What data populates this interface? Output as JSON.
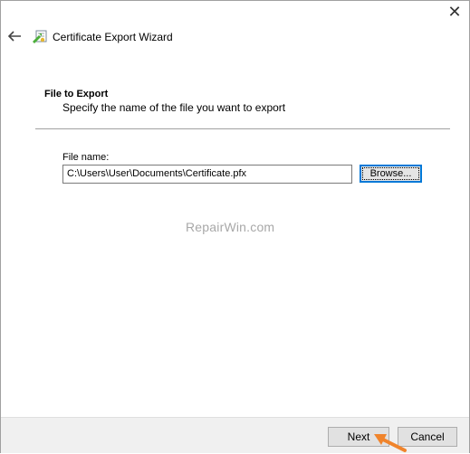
{
  "window": {
    "title": "Certificate Export Wizard",
    "close_icon": "close-icon",
    "back_icon": "back-arrow-icon",
    "wizard_icon": "certificate-icon"
  },
  "section": {
    "title": "File to Export",
    "description": "Specify the name of the file you want to export"
  },
  "file": {
    "label": "File name:",
    "value": "C:\\Users\\User\\Documents\\Certificate.pfx",
    "browse_label": "Browse..."
  },
  "watermark": "RepairWin.com",
  "footer": {
    "next_label": "Next",
    "cancel_label": "Cancel"
  },
  "colors": {
    "accent": "#0078d7",
    "annotation_arrow": "#f0842c"
  }
}
